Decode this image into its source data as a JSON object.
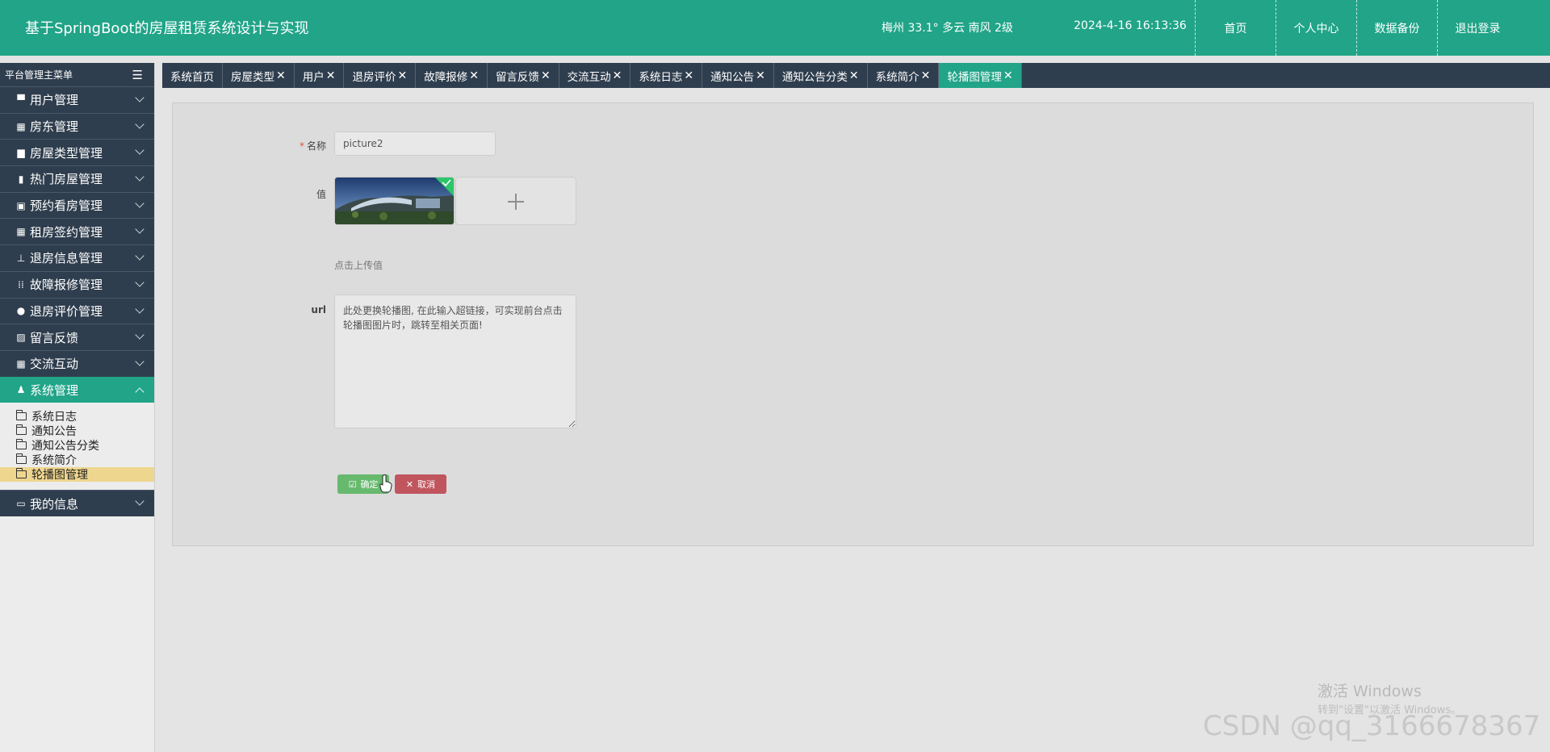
{
  "header": {
    "title": "基于SpringBoot的房屋租赁系统设计与实现",
    "weather": "梅州  33.1°  多云  南风  2级",
    "datetime": "2024-4-16 16:13:36",
    "nav": [
      "首页",
      "个人中心",
      "数据备份",
      "退出登录"
    ]
  },
  "sidebar": {
    "title": "平台管理主菜单",
    "items": [
      {
        "label": "用户管理",
        "icon": "comment-icon"
      },
      {
        "label": "房东管理",
        "icon": "grid-icon"
      },
      {
        "label": "房屋类型管理",
        "icon": "printer-icon"
      },
      {
        "label": "热门房屋管理",
        "icon": "library-icon"
      },
      {
        "label": "预约看房管理",
        "icon": "clipboard-icon"
      },
      {
        "label": "租房签约管理",
        "icon": "grid-icon"
      },
      {
        "label": "退房信息管理",
        "icon": "stamp-icon"
      },
      {
        "label": "故障报修管理",
        "icon": "apps-icon"
      },
      {
        "label": "退房评价管理",
        "icon": "bulb-icon"
      },
      {
        "label": "留言反馈",
        "icon": "chart-icon"
      },
      {
        "label": "交流互动",
        "icon": "grid-icon"
      },
      {
        "label": "系统管理",
        "icon": "user-icon"
      }
    ],
    "submenu": [
      "系统日志",
      "通知公告",
      "通知公告分类",
      "系统简介",
      "轮播图管理"
    ],
    "bottom_item": {
      "label": "我的信息",
      "icon": "card-icon"
    }
  },
  "tabs": [
    "系统首页",
    "房屋类型",
    "用户",
    "退房评价",
    "故障报修",
    "留言反馈",
    "交流互动",
    "系统日志",
    "通知公告",
    "通知公告分类",
    "系统简介",
    "轮播图管理"
  ],
  "form": {
    "name_label": "名称",
    "name_value": "picture2",
    "value_label": "值",
    "upload_hint": "点击上传值",
    "url_label": "url",
    "url_value": "此处更换轮播图, 在此输入超链接，可实现前台点击轮播图图片时，跳转至相关页面!",
    "ok_label": "确定",
    "cancel_label": "取消"
  },
  "watermark": {
    "win_line1": "激活 Windows",
    "win_line2": "转到\"设置\"以激活 Windows。",
    "csdn": "CSDN @qq_3166678367"
  },
  "colors": {
    "primary": "#21a488",
    "dark_nav": "#2f3e4e",
    "submenu_active": "#efd68e",
    "ok_button": "#67b96e",
    "cancel_button": "#c0555e"
  }
}
